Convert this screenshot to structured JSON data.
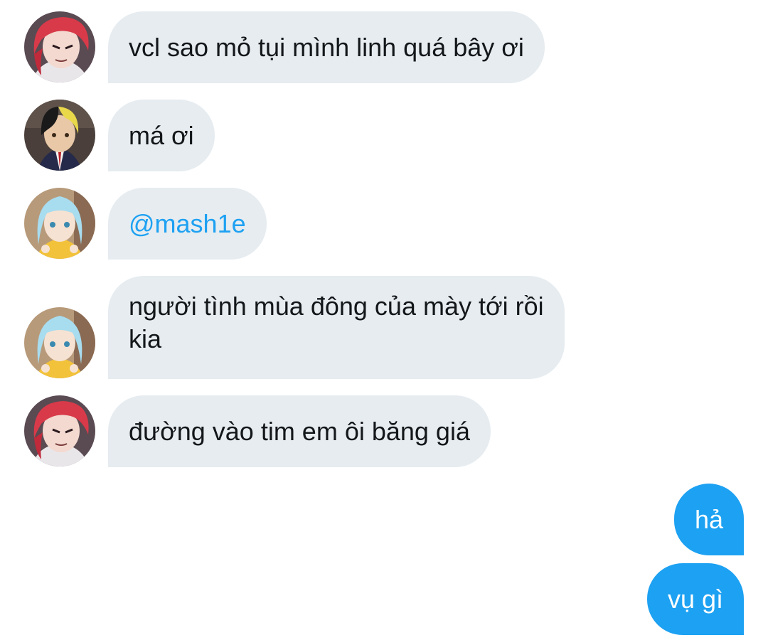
{
  "messages": [
    {
      "text": "vcl sao mỏ tụi mình linh quá bây ơi",
      "avatar": "avatar-red-hair"
    },
    {
      "text": "má ơi",
      "avatar": "avatar-black-yellow-hair"
    },
    {
      "text": "@mash1e",
      "avatar": "avatar-light-blue-hair",
      "type": "mention"
    },
    {
      "text_line1": "người tình mùa đông của mày tới rồi",
      "text_line2": "kia",
      "avatar": "avatar-light-blue-hair"
    },
    {
      "text": "đường vào tim em ôi băng giá",
      "avatar": "avatar-red-hair"
    },
    {
      "text": "hả",
      "outgoing": true
    },
    {
      "text": "vụ gì",
      "outgoing": true
    }
  ],
  "colors": {
    "incoming_bubble": "#e6ecf0",
    "outgoing_bubble": "#1da1f2",
    "mention": "#1da1f2",
    "text": "#14171a"
  }
}
